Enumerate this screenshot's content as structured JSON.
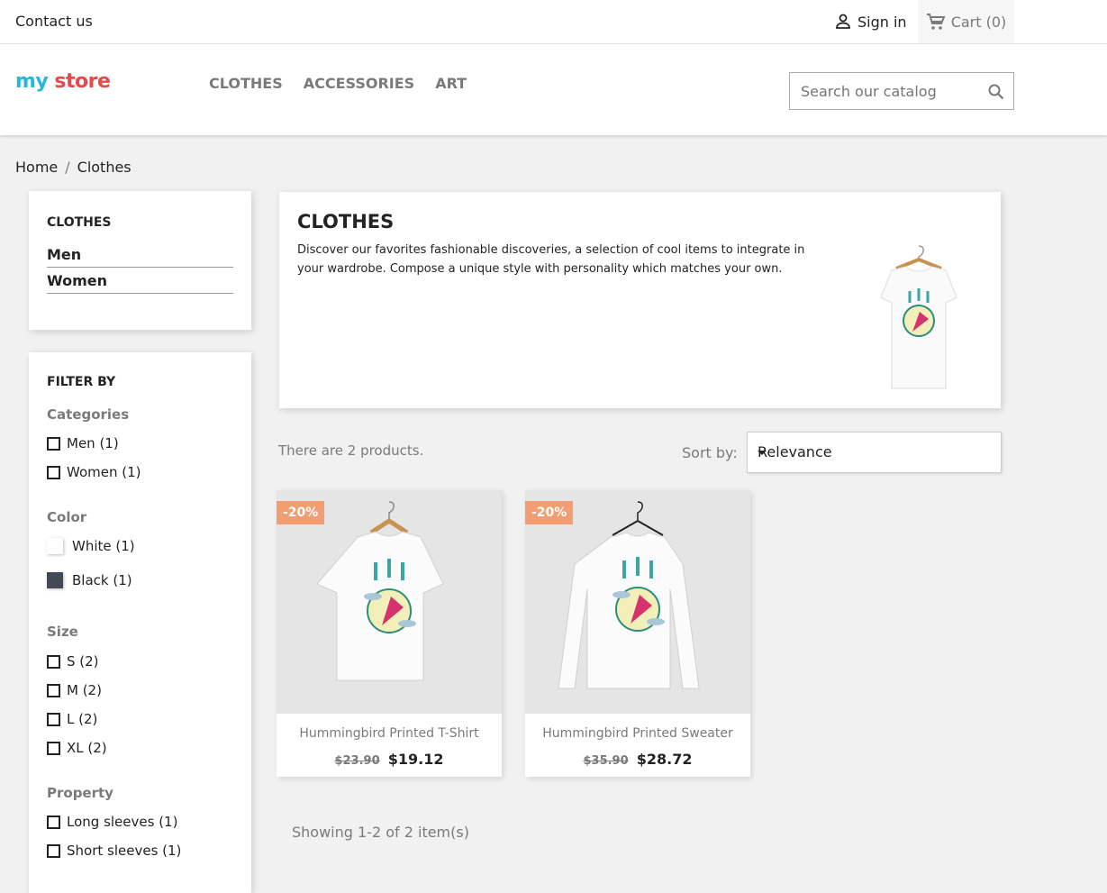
{
  "topbar": {
    "contact": "Contact us",
    "signin": "Sign in",
    "cart": "Cart (0)"
  },
  "header": {
    "logo": {
      "part1": "my",
      "part2": " store"
    },
    "nav": [
      "CLOTHES",
      "ACCESSORIES",
      "ART"
    ],
    "search_placeholder": "Search our catalog"
  },
  "breadcrumb": [
    "Home",
    "Clothes"
  ],
  "categories": {
    "title": "CLOTHES",
    "items": [
      "Men",
      "Women"
    ]
  },
  "filters": {
    "title": "FILTER BY",
    "categories": {
      "label": "Categories",
      "options": [
        "Men (1)",
        "Women (1)"
      ]
    },
    "color": {
      "label": "Color",
      "options": [
        {
          "label": "White (1)",
          "color": "#ffffff"
        },
        {
          "label": "Black (1)",
          "color": "#434a54"
        }
      ]
    },
    "size": {
      "label": "Size",
      "options": [
        "S (2)",
        "M (2)",
        "L (2)",
        "XL (2)"
      ]
    },
    "property": {
      "label": "Property",
      "options": [
        "Long sleeves (1)",
        "Short sleeves (1)"
      ]
    }
  },
  "hero": {
    "title": "CLOTHES",
    "description": "Discover our favorites fashionable discoveries, a selection of cool items to integrate in your wardrobe. Compose a unique style with personality which matches your own."
  },
  "listing": {
    "count": "There are 2 products.",
    "sort_label": "Sort by:",
    "sort_value": "Relevance",
    "products": [
      {
        "name": "Hummingbird Printed T-Shirt",
        "badge": "-20%",
        "old_price": "$23.90",
        "price": "$19.12"
      },
      {
        "name": "Hummingbird Printed Sweater",
        "badge": "-20%",
        "old_price": "$35.90",
        "price": "$28.72"
      }
    ],
    "showing": "Showing 1-2 of 2 item(s)"
  },
  "colors": {
    "badge": "#f39d72",
    "accent": "#24b9d7"
  }
}
